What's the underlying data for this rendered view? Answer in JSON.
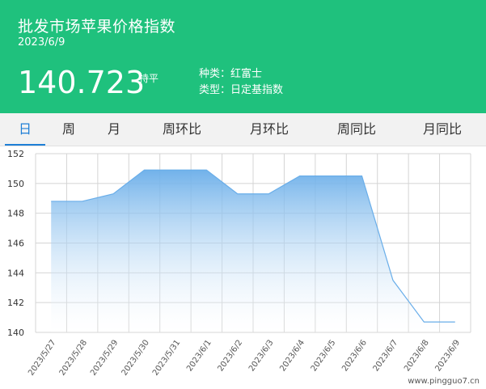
{
  "header": {
    "title": "批发市场苹果价格指数",
    "date": "2023/6/9",
    "price": "140.723",
    "trend": "持平",
    "variety": "种类：红富士",
    "type": "类型：日定基指数"
  },
  "tabs": [
    {
      "label": "日",
      "active": true
    },
    {
      "label": "周",
      "active": false
    },
    {
      "label": "月",
      "active": false
    },
    {
      "label": "周环比",
      "active": false
    },
    {
      "label": "月环比",
      "active": false
    },
    {
      "label": "周同比",
      "active": false
    },
    {
      "label": "月同比",
      "active": false
    }
  ],
  "chart_data": {
    "type": "area",
    "categories": [
      "2023/5/27",
      "2023/5/28",
      "2023/5/29",
      "2023/5/30",
      "2023/5/31",
      "2023/6/1",
      "2023/6/2",
      "2023/6/3",
      "2023/6/4",
      "2023/6/5",
      "2023/6/6",
      "2023/6/7",
      "2023/6/8",
      "2023/6/9"
    ],
    "values": [
      148.8,
      148.8,
      149.3,
      150.9,
      150.9,
      150.9,
      149.3,
      149.3,
      150.5,
      150.5,
      150.5,
      143.5,
      140.7,
      140.7
    ],
    "ylim": [
      140,
      152
    ],
    "yticks": [
      140,
      142,
      144,
      146,
      148,
      150,
      152
    ],
    "grid": true,
    "colors": {
      "line": "#6aaee9",
      "fill_top": "#6aaee9",
      "fill_bottom": "#ffffff",
      "grid": "#d4d4d4"
    }
  },
  "watermark": "www.pingguo7.cn"
}
